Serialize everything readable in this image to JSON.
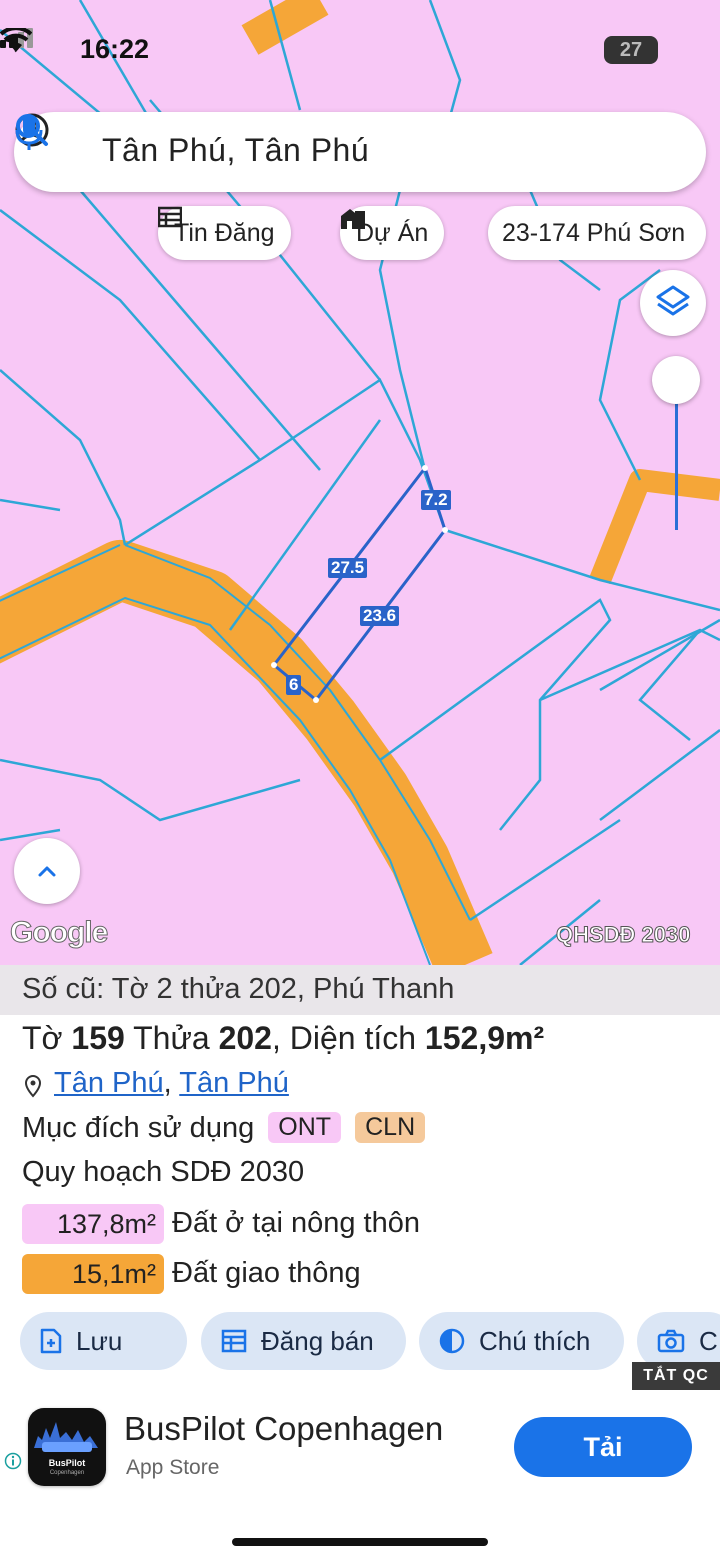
{
  "status_bar": {
    "time": "16:22",
    "battery": "27"
  },
  "search": {
    "text": "Tân Phú, Tân Phú"
  },
  "chips": {
    "listings": "Tin Đăng",
    "projects": "Dự Án",
    "address": "23-174 Phú Sơn"
  },
  "map": {
    "parcel_edges": [
      "7.2",
      "27.5",
      "23.6",
      "6"
    ],
    "attribution": "Google",
    "layer_label": "QHSDĐ 2030",
    "colors": {
      "residential": "#f8c8f6",
      "road": "#f5a638",
      "parcel_line": "#2ea7d6",
      "selection": "#2a63c9"
    }
  },
  "panel": {
    "old_info": "Số cũ: Tờ 2 thửa 202, Phú Thanh",
    "title": {
      "sheet_label": "Tờ",
      "sheet": "159",
      "parcel_label": "Thửa",
      "parcel": "202",
      "area_label": ", Diện tích",
      "area": "152,9m²"
    },
    "location": {
      "commune": "Tân Phú",
      "district": "Tân Phú",
      "separator": ","
    },
    "purpose": {
      "label": "Mục đích sử dụng",
      "tags": [
        "ONT",
        "CLN"
      ]
    },
    "planning": "Quy hoạch SDĐ 2030",
    "areas": [
      {
        "value": "137,8m²",
        "label": "Đất ở tại nông thôn",
        "color": "#f8c8f6"
      },
      {
        "value": "15,1m²",
        "label": "Đất giao thông",
        "color": "#f5a638"
      }
    ],
    "actions": {
      "save": "Lưu",
      "sell": "Đăng bán",
      "legend": "Chú thích",
      "camera": "C"
    }
  },
  "ad": {
    "off_label": "TẮT QC",
    "icon_text": "BusPilot",
    "icon_subtext": "Copenhagen",
    "title": "BusPilot Copenhagen",
    "store": "App Store",
    "install": "Tải"
  }
}
